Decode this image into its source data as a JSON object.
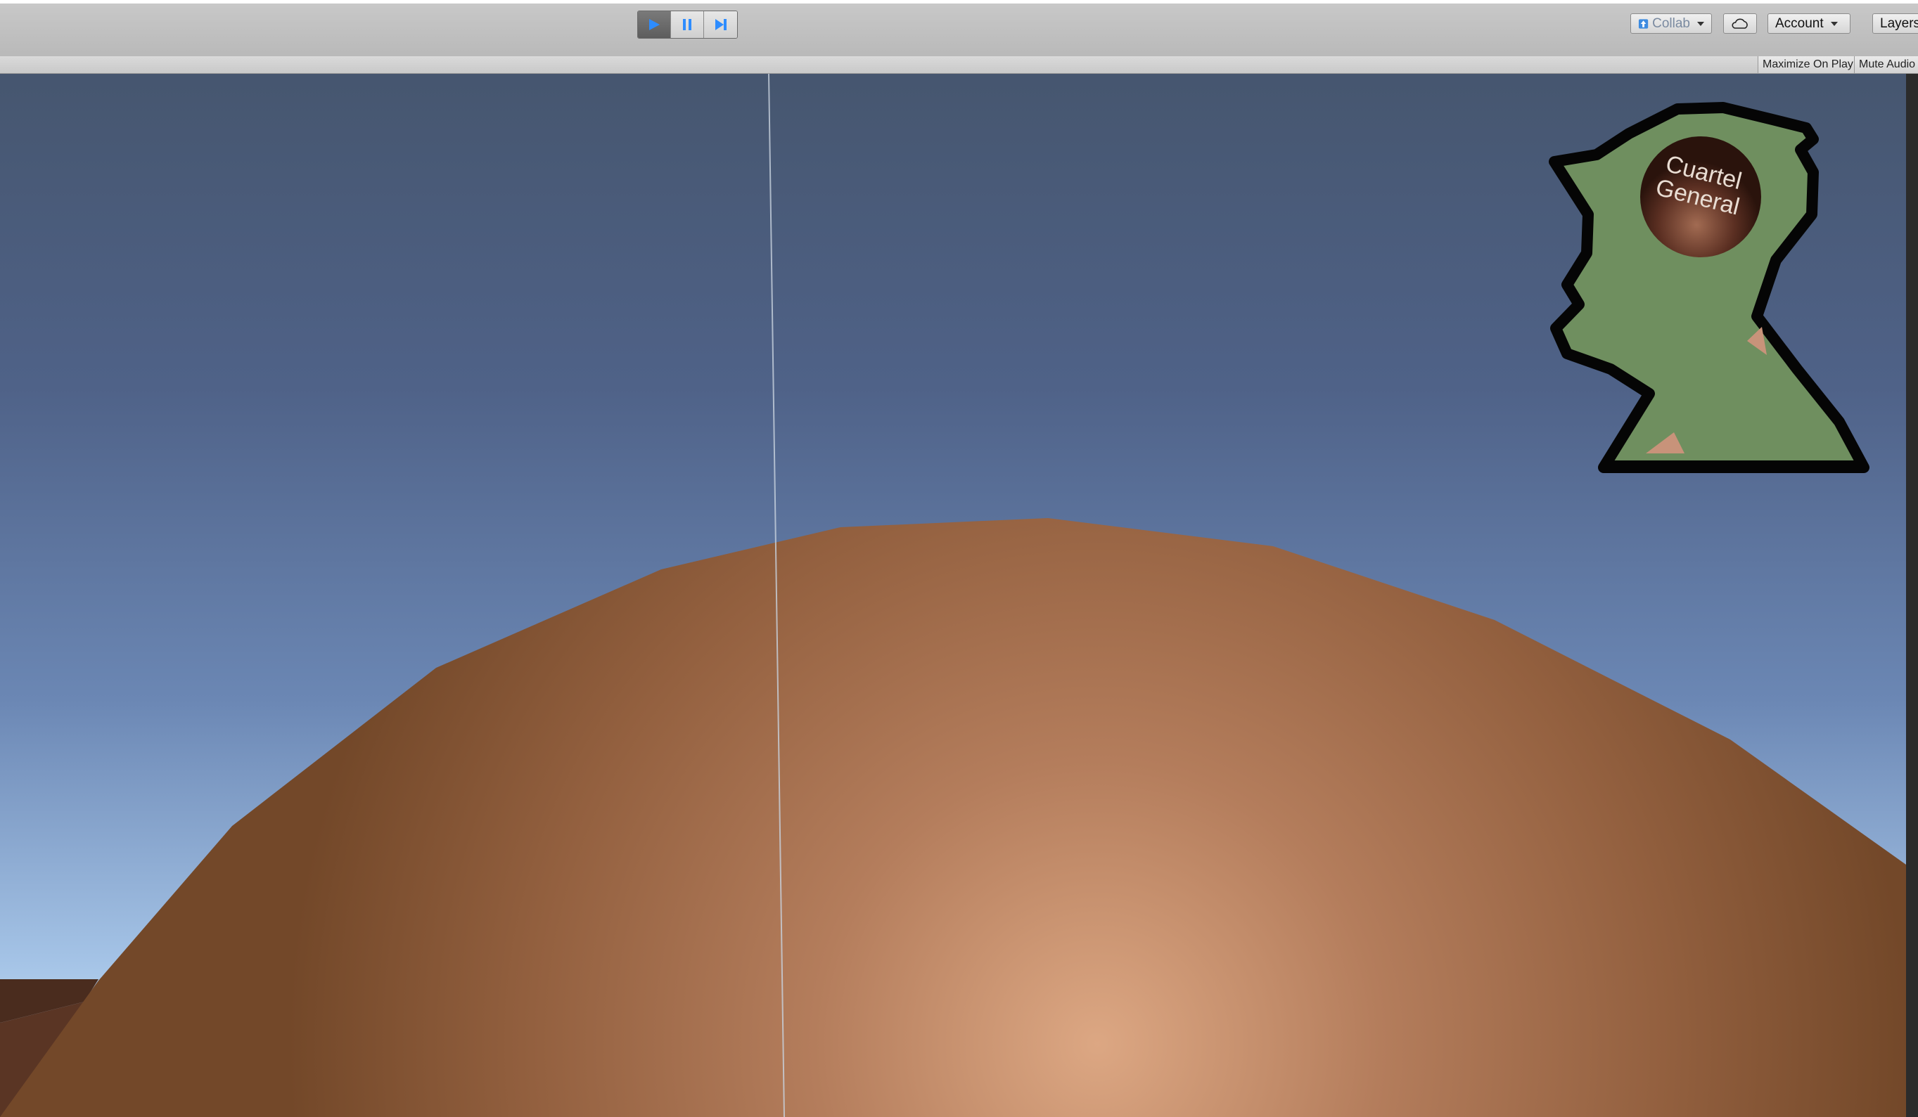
{
  "toolbar": {
    "play_controls": [
      {
        "name": "play",
        "icon": "play-icon",
        "active": true
      },
      {
        "name": "pause",
        "icon": "pause-icon",
        "active": false
      },
      {
        "name": "step",
        "icon": "step-icon",
        "active": false
      }
    ],
    "collab_label": "Collab",
    "cloud_icon": "cloud-icon",
    "account_label": "Account",
    "layers_label": "Layers"
  },
  "game_view": {
    "maximize_on_play_label": "Maximize On Play",
    "mute_audio_label": "Mute Audio"
  },
  "hud": {
    "title": "Cuartel\nGeneral"
  },
  "colors": {
    "accent": "#3a86ff",
    "sky_top": "#46566f",
    "sky_horizon": "#d7ecfb",
    "terrain": "#8a5a3c",
    "silhouette": "#6f8f5f"
  }
}
